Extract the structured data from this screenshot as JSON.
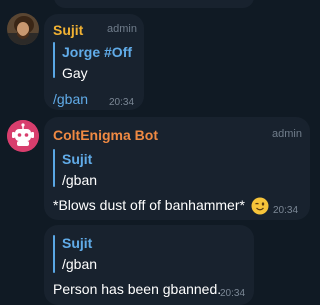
{
  "messages": [
    {
      "sender": "Sujit",
      "role": "admin",
      "reply_name": "Jorge #Off",
      "reply_text": "Gay",
      "text": "/gban",
      "time": "20:34"
    },
    {
      "sender": "ColtEnigma Bot",
      "role": "admin",
      "reply_name": "Sujit",
      "reply_text": "/gban",
      "text": "*Blows dust off of banhammer*",
      "emoji": "wink-emoji",
      "time": "20:34"
    },
    {
      "reply_name": "Sujit",
      "reply_text": "/gban",
      "text": "Person has been gbanned.",
      "time": "20:34"
    }
  ],
  "colors": {
    "background": "#101a24",
    "bubble": "#18222e",
    "sender_sujit": "#f2b233",
    "sender_bot": "#f08a43",
    "accent": "#61ace9",
    "bot_avatar": "#d83e6d"
  }
}
